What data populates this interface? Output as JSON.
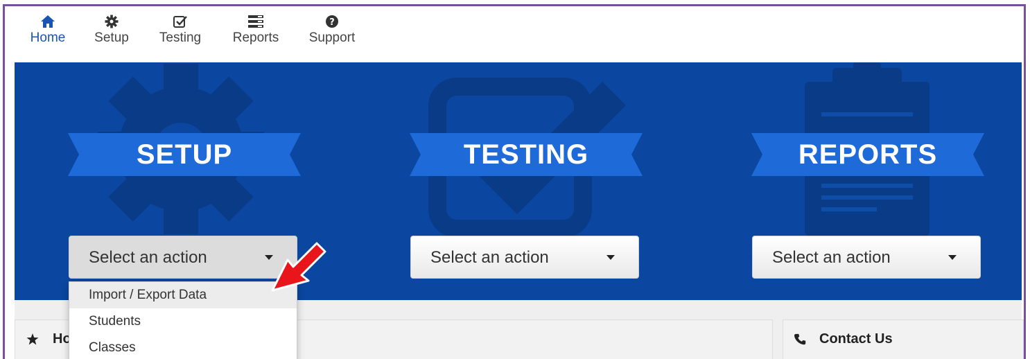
{
  "nav": {
    "items": [
      {
        "label": "Home",
        "icon": "home-icon",
        "active": true
      },
      {
        "label": "Setup",
        "icon": "gear-icon",
        "active": false
      },
      {
        "label": "Testing",
        "icon": "checkbox-icon",
        "active": false
      },
      {
        "label": "Reports",
        "icon": "list-icon",
        "active": false
      },
      {
        "label": "Support",
        "icon": "question-icon",
        "active": false
      }
    ]
  },
  "hero": {
    "sections": [
      {
        "title": "SETUP",
        "select_label": "Select an action",
        "bg_icon": "gear-icon"
      },
      {
        "title": "TESTING",
        "select_label": "Select an action",
        "bg_icon": "checkbox-icon"
      },
      {
        "title": "REPORTS",
        "select_label": "Select an action",
        "bg_icon": "clipboard-icon"
      }
    ]
  },
  "setup_menu": {
    "items": [
      "Import / Export Data",
      "Students",
      "Classes"
    ],
    "highlighted_index": 0
  },
  "panels": {
    "home": {
      "title": "Ho",
      "icon": "star-icon"
    },
    "contact": {
      "title": "Contact Us",
      "icon": "phone-icon"
    }
  },
  "colors": {
    "hero_bg": "#0b47a0",
    "ribbon": "#1d6ad8",
    "nav_active": "#1a55b5",
    "annotation_arrow": "#e8161b",
    "frame_border": "#7a4fa0"
  }
}
